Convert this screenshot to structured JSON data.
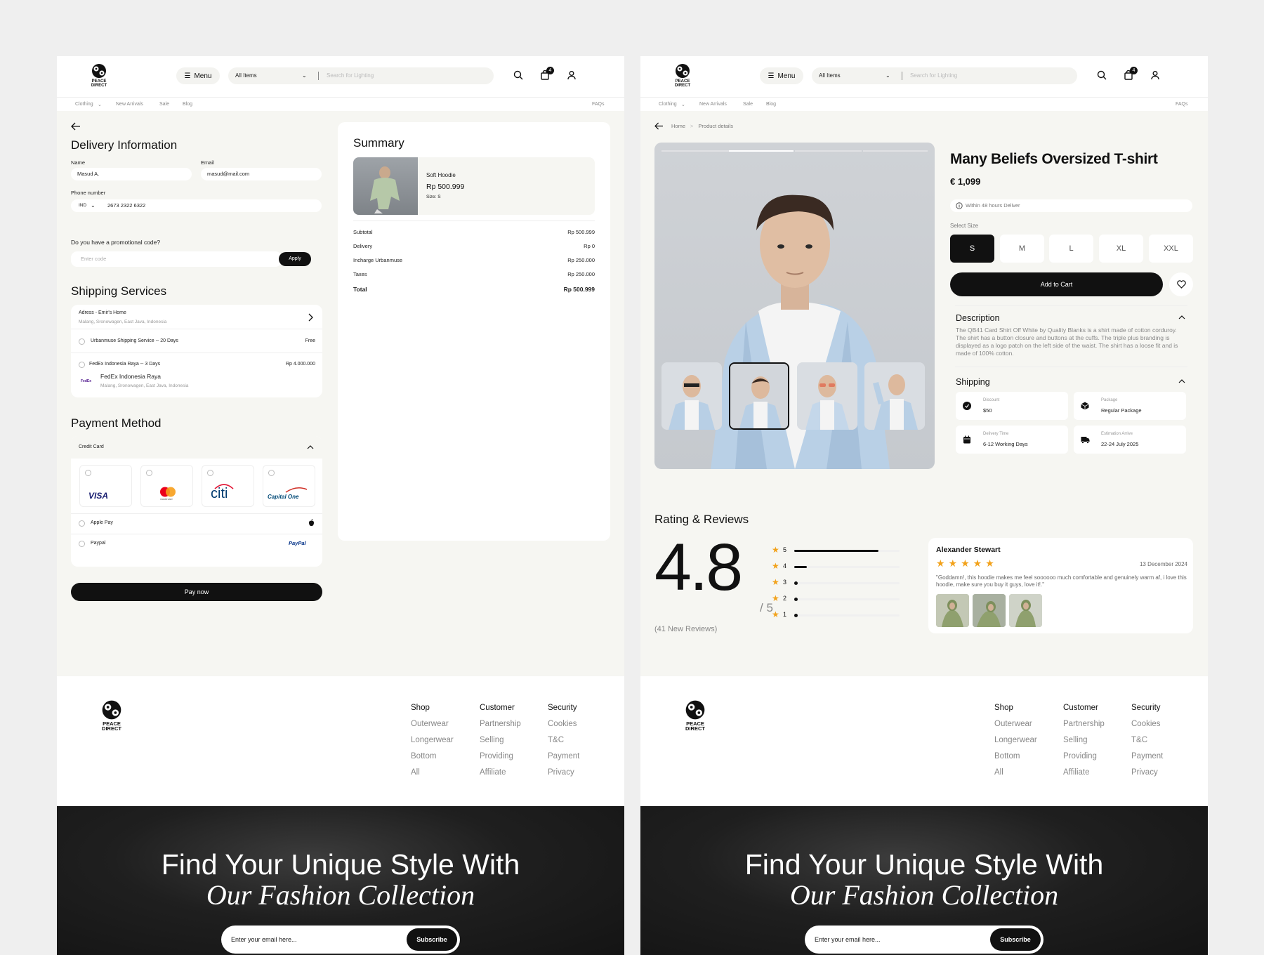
{
  "brand": {
    "logo_text": "PEACE DIRECT"
  },
  "header": {
    "menu_label": "Menu",
    "category_value": "All Items",
    "search_placeholder": "Search for Lighting",
    "cart_count": "4"
  },
  "subnav": {
    "items": [
      "Clothing",
      "New Arrivals",
      "Sale",
      "Blog"
    ],
    "faqs": "FAQs"
  },
  "checkout": {
    "delivery_title": "Delivery Information",
    "name_label": "Name",
    "name_value": "Masud A.",
    "email_label": "Email",
    "email_value": "masud@mail.com",
    "phone_label": "Phone number",
    "phone_country": "IND",
    "phone_value": "2673 2322 6322",
    "promo_question": "Do you have a promotional code?",
    "promo_placeholder": "Enter code",
    "apply_label": "Apply",
    "shipping_title": "Shipping Services",
    "address_title": "Adress - Emir's Home",
    "address_detail": "Malang, Sronowagen, East Java, Indonesia",
    "ship_options": [
      {
        "label": "Urbanmuse Shipping Service -- 20 Days",
        "price": "Free"
      },
      {
        "label": "FedEx Indonesia Raya -- 3 Days",
        "price": "Rp 4.000.000",
        "sub_title": "FedEx Indonesia Raya",
        "sub_detail": "Malang, Sronowagen, East Java, Indonesia",
        "logo": "FedEx"
      }
    ],
    "payment_title": "Payment Method",
    "credit_card_label": "Credit Card",
    "cards": [
      "VISA",
      "mastercard",
      "citi",
      "Capital One"
    ],
    "apple_pay": "Apple Pay",
    "paypal": "Paypal",
    "paypal_logo": "PayPal",
    "pay_now": "Pay now"
  },
  "summary": {
    "title": "Summary",
    "product_name": "Soft Hoodie",
    "product_price": "Rp 500.999",
    "product_size": "Size: S",
    "rows": [
      {
        "label": "Subtotal",
        "value": "Rp 500.999"
      },
      {
        "label": "Delivery",
        "value": "Rp 0"
      },
      {
        "label": "Incharge Urbanmuse",
        "value": "Rp 250.000"
      },
      {
        "label": "Taxes",
        "value": "Rp 250.000"
      }
    ],
    "total_label": "Total",
    "total_value": "Rp 500.999"
  },
  "product": {
    "breadcrumb_home": "Home",
    "breadcrumb_sep": ">",
    "breadcrumb_current": "Product details",
    "name": "Many Beliefs Oversized T-shirt",
    "price": "€ 1,099",
    "delivery_note": "Within 48 hours Deliver",
    "select_size_label": "Select Size",
    "sizes": [
      "S",
      "M",
      "L",
      "XL",
      "XXL"
    ],
    "selected_size": "S",
    "add_to_cart": "Add to Cart",
    "description_title": "Description",
    "description_text": "The QB41 Card Shirt Off White by Quality Blanks is a shirt made of cotton corduroy. The shirt has a button closure and buttons at the cuffs. The triple plus branding is displayed as a logo patch on the left side of the waist. The shirt has a loose fit and is made of 100% cotton.",
    "shipping_title": "Shipping",
    "shipping_items": [
      {
        "label": "Discount",
        "value": "$50"
      },
      {
        "label": "Package",
        "value": "Regular Package"
      },
      {
        "label": "Delivery Time",
        "value": "6-12 Working Days"
      },
      {
        "label": "Estimation Arrive",
        "value": "22-24 July 2025"
      }
    ]
  },
  "reviews": {
    "title": "Rating & Reviews",
    "score": "4.8",
    "out_of": "/ 5",
    "count_text": "(41 New Reviews)",
    "bars": [
      {
        "star": "5",
        "fraction": 0.8
      },
      {
        "star": "4",
        "fraction": 0.12
      },
      {
        "star": "3",
        "fraction": 0.03
      },
      {
        "star": "2",
        "fraction": 0.02
      },
      {
        "star": "1",
        "fraction": 0.02
      }
    ],
    "review": {
      "author": "Alexander Stewart",
      "rating": 5,
      "date": "13 December 2024",
      "text": "\"Goddamn!, this hoodie makes me feel soooooo much comfortable and genuinely warm af, i love this hoodie, make sure you buy it guys, love it!.\""
    }
  },
  "footer": {
    "columns": [
      {
        "heading": "Shop",
        "links": [
          "Outerwear",
          "Longerwear",
          "Bottom",
          "All"
        ]
      },
      {
        "heading": "Customer",
        "links": [
          "Partnership",
          "Selling",
          "Providing",
          "Affiliate"
        ]
      },
      {
        "heading": "Security",
        "links": [
          "Cookies",
          "T&C",
          "Payment",
          "Privacy"
        ]
      }
    ]
  },
  "banner": {
    "line1": "Find Your Unique Style With",
    "line2": "Our Fashion Collection",
    "email_placeholder": "Enter your email here...",
    "subscribe": "Subscribe"
  },
  "colors": {
    "accent": "#111111",
    "star": "#f2a21b",
    "bg": "#f6f6f2"
  }
}
